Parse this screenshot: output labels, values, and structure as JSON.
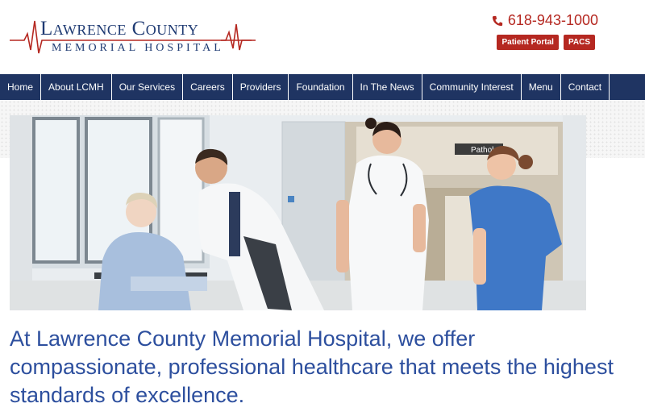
{
  "logo": {
    "line1": "Lawrence County",
    "line2": "MEMORIAL HOSPITAL"
  },
  "header": {
    "phone": "618-943-1000",
    "phone_icon": "phone-icon",
    "buttons": [
      "Patient Portal",
      "PACS"
    ]
  },
  "nav": {
    "items": [
      "Home",
      "About LCMH",
      "Our Services",
      "Careers",
      "Providers",
      "Foundation",
      "In The News",
      "Community Interest",
      "Menu",
      "Contact"
    ]
  },
  "hero": {
    "sign_text": "Pathol"
  },
  "tagline": "At Lawrence County Memorial Hospital, we offer compassionate, professional healthcare that meets the highest standards of excellence.",
  "colors": {
    "brand_navy": "#1f3462",
    "brand_red": "#b52821",
    "tagline_blue": "#2d4f9e"
  }
}
